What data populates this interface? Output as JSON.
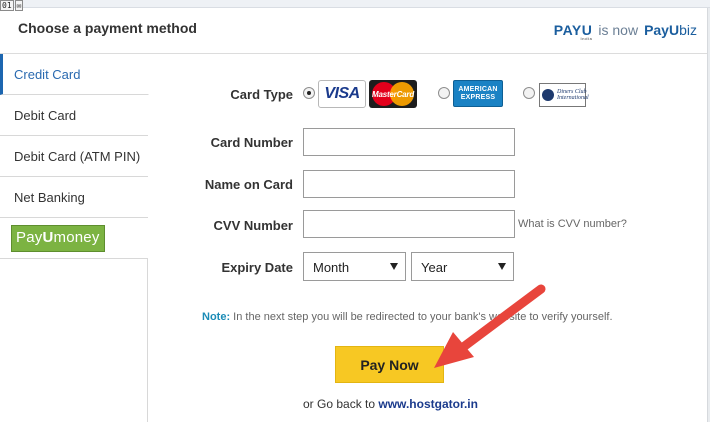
{
  "frame": {
    "badge_left": "01"
  },
  "header": {
    "title": "Choose a payment method",
    "brand_logo": "PAYU",
    "brand_sub": "India",
    "brand_is_now": "is now",
    "brand_new_prefix": "PayU",
    "brand_new_suffix": "biz"
  },
  "sidebar": {
    "items": [
      {
        "label": "Credit Card",
        "active": true
      },
      {
        "label": "Debit Card",
        "active": false
      },
      {
        "label": "Debit Card (ATM PIN)",
        "active": false
      },
      {
        "label": "Net Banking",
        "active": false
      }
    ],
    "payumoney": {
      "prefix": "Pay",
      "u": "U",
      "suffix": "money"
    }
  },
  "form": {
    "card_type_label": "Card Type",
    "card_logos": {
      "visa": "VISA",
      "mastercard": "MasterCard",
      "amex_line1": "AMERICAN",
      "amex_line2": "EXPRESS",
      "diners_line1": "Diners Club",
      "diners_line2": "International"
    },
    "card_number_label": "Card Number",
    "card_number_value": "",
    "name_label": "Name on Card",
    "name_value": "",
    "cvv_label": "CVV Number",
    "cvv_value": "",
    "cvv_hint": "What is CVV number?",
    "expiry_label": "Expiry Date",
    "month_selected": "Month",
    "year_selected": "Year"
  },
  "note": {
    "prefix": "Note:",
    "text": "In the next step you will be redirected to your bank's website to verify yourself."
  },
  "pay_button": "Pay Now",
  "go_back": {
    "text": "or Go back to",
    "link": "www.hostgator.in"
  },
  "colors": {
    "accent_blue": "#1c66b0",
    "pay_button": "#f7c823",
    "payumoney_green": "#7cb342",
    "annotation_arrow": "#e8453c"
  }
}
